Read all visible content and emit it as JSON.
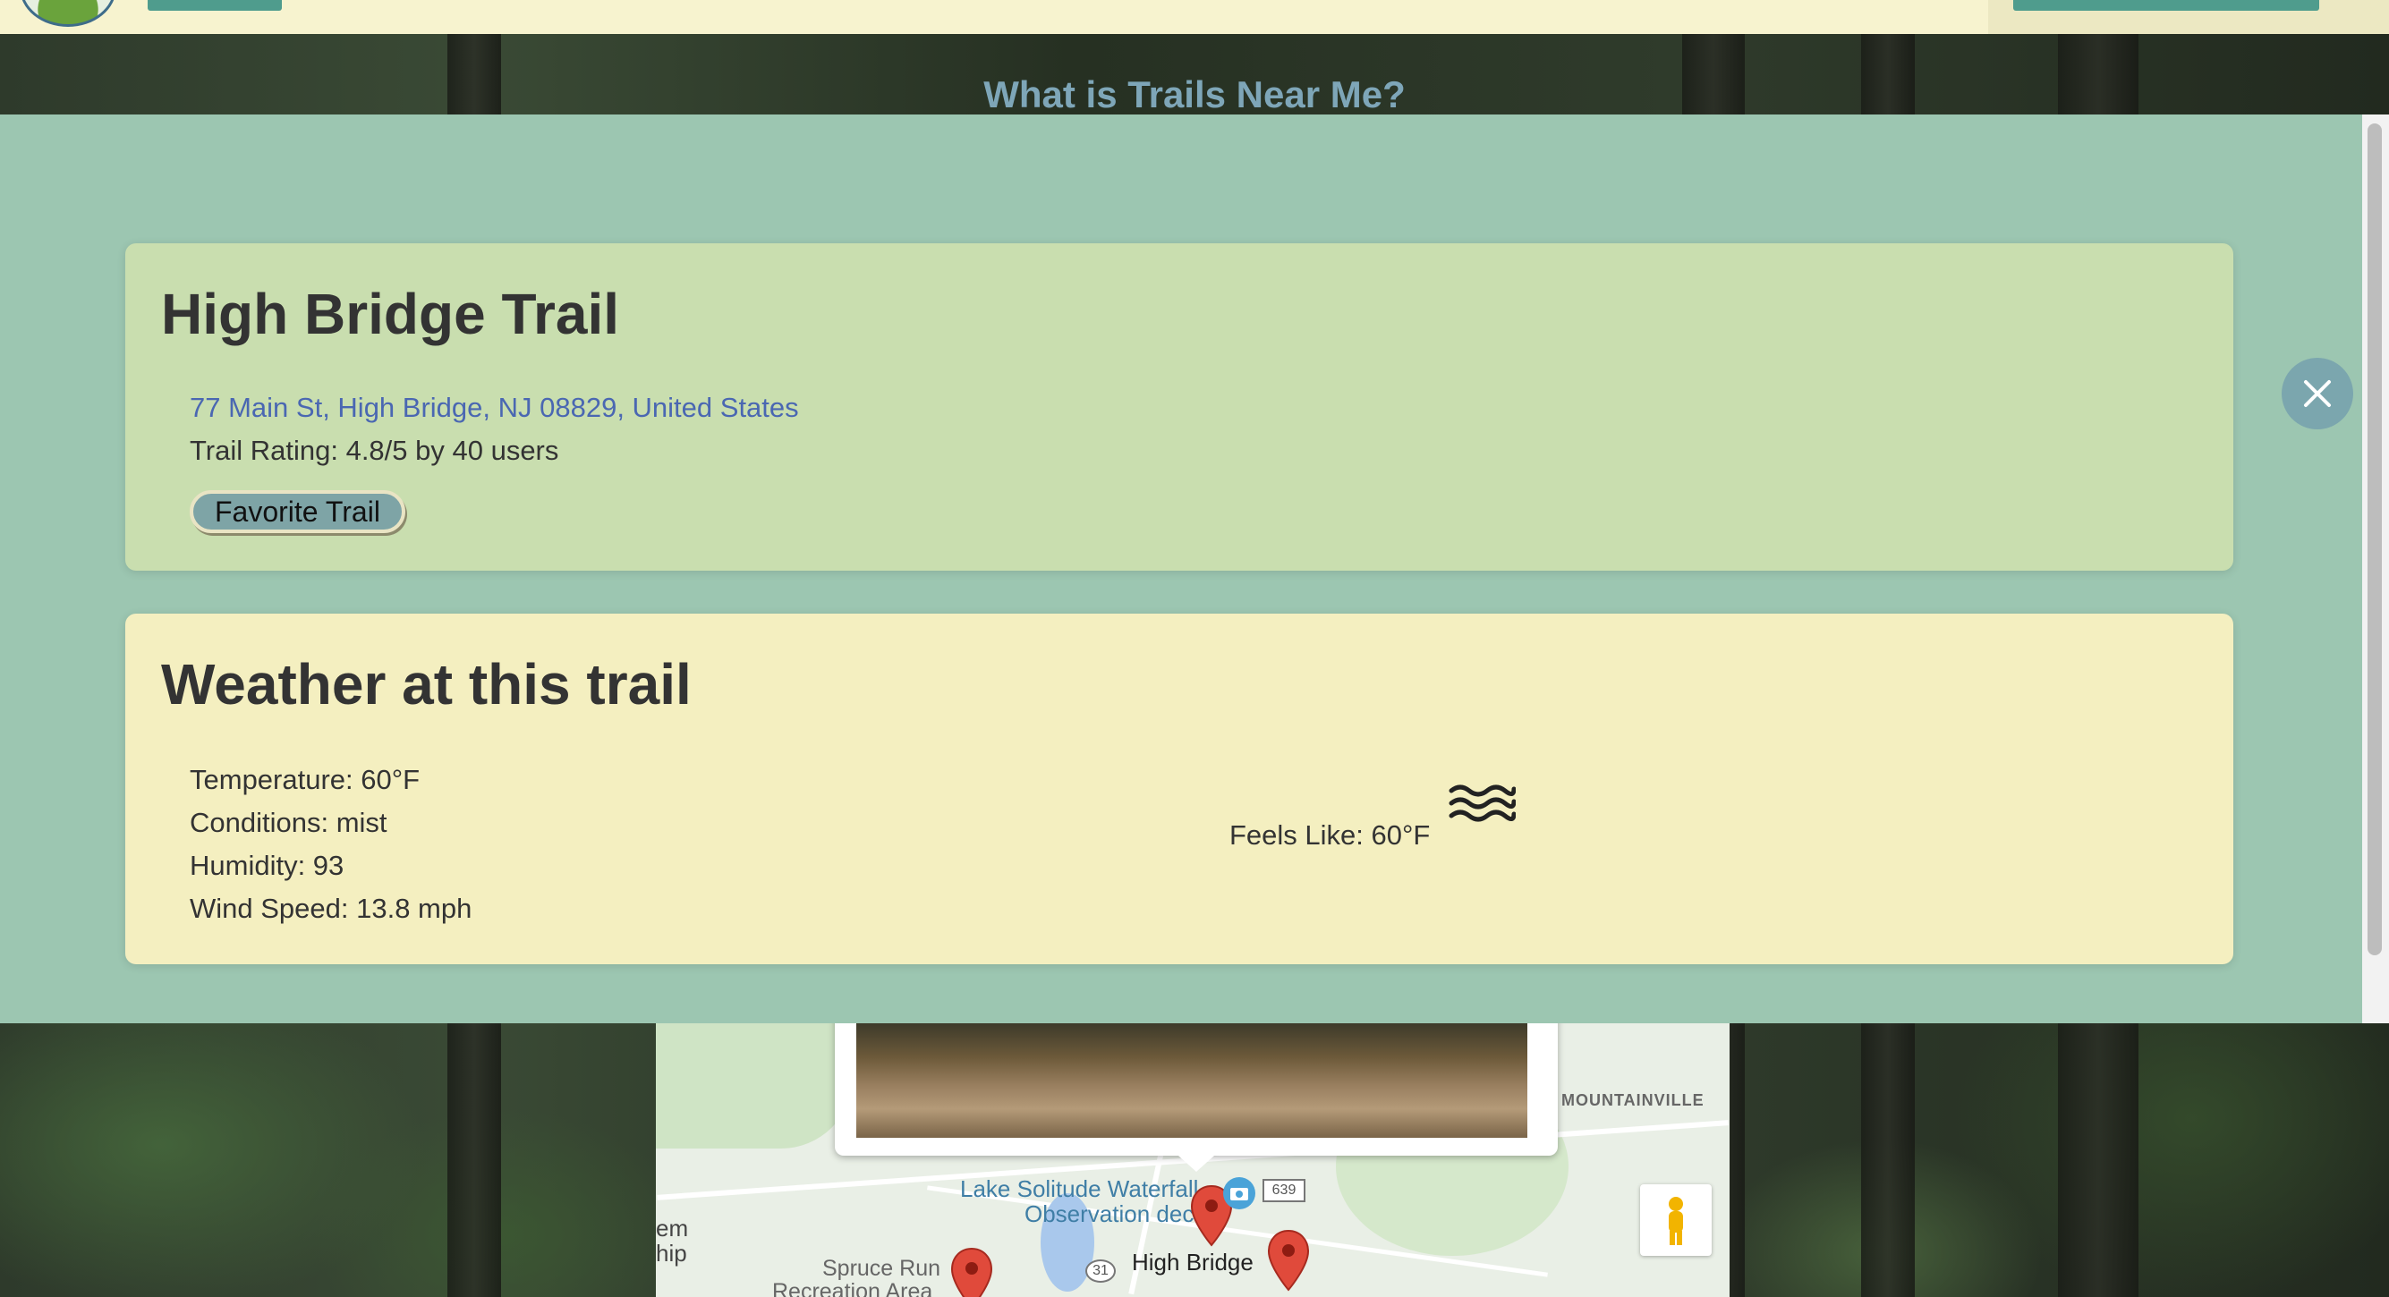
{
  "header": {
    "hero_heading": "What is Trails Near Me?"
  },
  "trail": {
    "name": "High Bridge Trail",
    "address": "77 Main St, High Bridge, NJ 08829, United States",
    "rating_text": "Trail Rating: 4.8/5 by 40 users",
    "favorite_label": "Favorite Trail"
  },
  "weather": {
    "title": "Weather at this trail",
    "temperature": "Temperature: 60°F",
    "conditions": "Conditions: mist",
    "humidity": "Humidity: 93",
    "wind": "Wind Speed: 13.8 mph",
    "feels_like": "Feels Like: 60°F",
    "icon": "mist-icon"
  },
  "map": {
    "labels": {
      "lake": "Lake Solitude Waterfall Observation deck",
      "lake_line1": "Lake Solitude Waterfall",
      "lake_line2": "Observation deck",
      "town": "High Bridge",
      "spruce_line1": "Spruce Run",
      "spruce_line2": "Recreation Area",
      "mountainville": "MOUNTAINVILLE",
      "edge_line1": "em",
      "edge_line2": "hip",
      "route31": "31",
      "route639": "639"
    }
  },
  "colors": {
    "modal_bg": "#9cc6b1",
    "trail_card_bg": "#c9deaf",
    "weather_card_bg": "#f4efc0",
    "link": "#4a67b2",
    "close_button": "#7ba6ae"
  }
}
